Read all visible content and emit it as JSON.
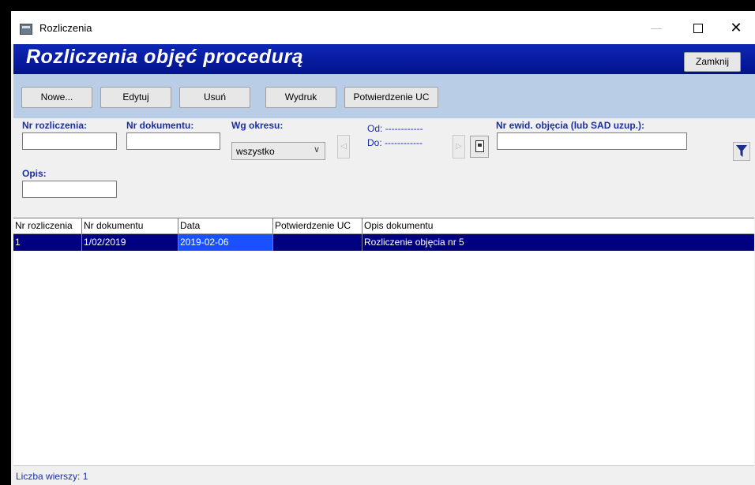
{
  "window": {
    "title": "Rozliczenia",
    "minimize_glyph": "—",
    "close_glyph": "✕"
  },
  "banner": {
    "title": "Rozliczenia objęć procedurą",
    "close_label": "Zamknij"
  },
  "toolbar": {
    "new_label": "Nowe...",
    "edit_label": "Edytuj",
    "delete_label": "Usuń",
    "print_label": "Wydruk",
    "confirm_label": "Potwierdzenie UC"
  },
  "filters": {
    "nr_rozliczenia_label": "Nr rozliczenia:",
    "nr_rozliczenia_value": "",
    "nr_dokumentu_label": "Nr dokumentu:",
    "nr_dokumentu_value": "",
    "period_label": "Wg okresu:",
    "period_value": "wszystko",
    "od_label": "Od:",
    "od_value": "------------",
    "do_label": "Do:",
    "do_value": "------------",
    "nr_ewid_label": "Nr ewid. objęcia (lub SAD uzup.):",
    "nr_ewid_value": "",
    "opis_label": "Opis:",
    "opis_value": ""
  },
  "table": {
    "columns": [
      "Nr rozliczenia",
      "Nr dokumentu",
      "Data",
      "Potwierdzenie UC",
      "Opis dokumentu"
    ],
    "rows": [
      [
        "1",
        "1/02/2019",
        "2019-02-06",
        "",
        "Rozliczenie objęcia nr 5"
      ]
    ]
  },
  "status": {
    "row_count_text": "Liczba wierszy: 1"
  },
  "colors": {
    "banner": "#0d27b6",
    "toolbar": "#b9cde6",
    "selected_row": "#000080",
    "label_blue": "#1a2fa3"
  },
  "icons": [
    "app-icon",
    "maximize-icon",
    "close-icon",
    "prev-arrow-icon",
    "next-arrow-icon",
    "calendar-icon",
    "funnel-icon"
  ]
}
